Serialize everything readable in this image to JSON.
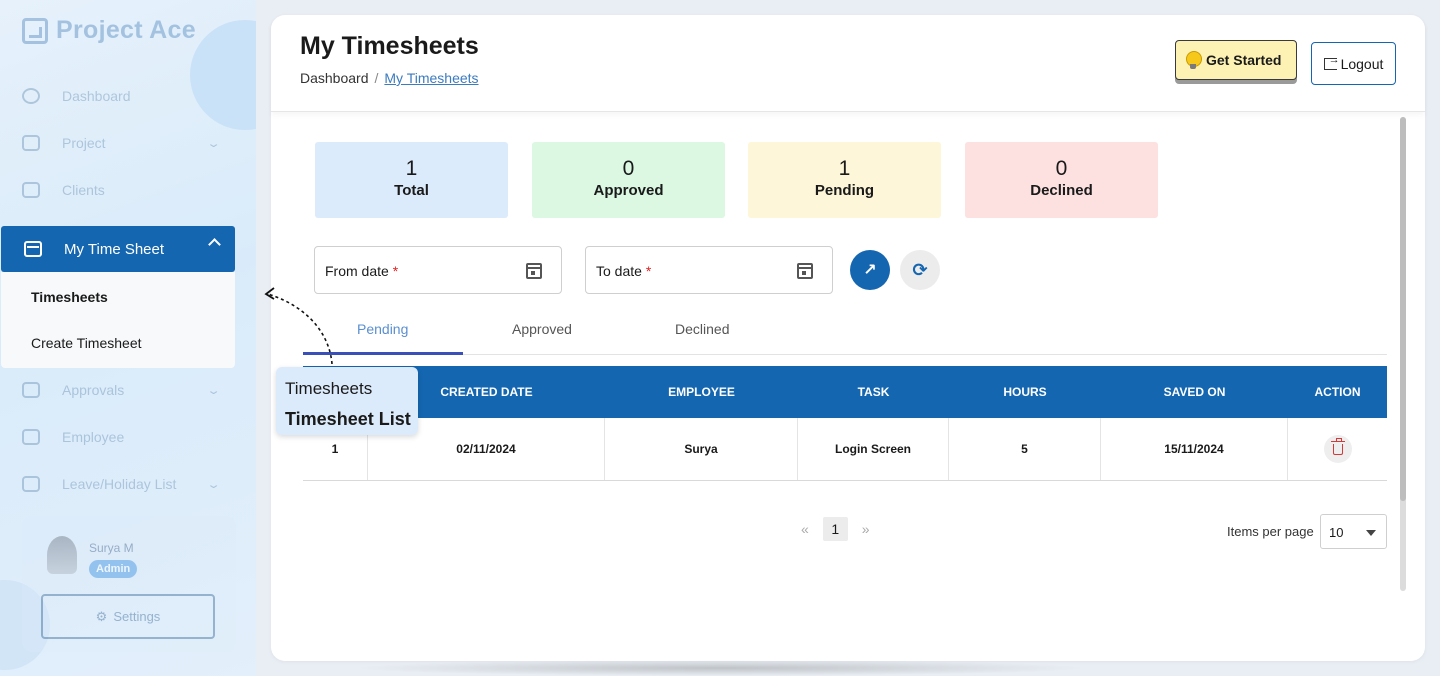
{
  "brand": {
    "name": "Project Ace"
  },
  "sidebar": {
    "items": [
      {
        "label": "Dashboard"
      },
      {
        "label": "Project"
      },
      {
        "label": "Clients"
      },
      {
        "label": "My Time Sheet"
      },
      {
        "label": "Approvals"
      },
      {
        "label": "Employee"
      },
      {
        "label": "Leave/Holiday List"
      }
    ],
    "submenu": [
      {
        "label": "Timesheets"
      },
      {
        "label": "Create Timesheet"
      }
    ],
    "profile": {
      "name": "Surya M",
      "role": "Admin",
      "settings_label": "Settings"
    }
  },
  "header": {
    "title": "My Timesheets",
    "breadcrumb": {
      "home": "Dashboard",
      "separator": "/",
      "current": "My Timesheets"
    },
    "get_started_label": "Get Started",
    "logout_label": "Logout"
  },
  "stats": {
    "total": {
      "value": "1",
      "label": "Total",
      "color": "#dcebfb"
    },
    "approved": {
      "value": "0",
      "label": "Approved",
      "color": "#dcf8e3"
    },
    "pending": {
      "value": "1",
      "label": "Pending",
      "color": "#fdf6d8"
    },
    "declined": {
      "value": "0",
      "label": "Declined",
      "color": "#fde1e1"
    }
  },
  "filters": {
    "from_label": "From date",
    "to_label": "To date",
    "required_mark": "*"
  },
  "tabs": [
    {
      "label": "Pending",
      "active": true
    },
    {
      "label": "Approved",
      "active": false
    },
    {
      "label": "Declined",
      "active": false
    }
  ],
  "table": {
    "columns": [
      "",
      "CREATED DATE",
      "EMPLOYEE",
      "TASK",
      "HOURS",
      "SAVED ON",
      "ACTION"
    ],
    "rows": [
      {
        "no": "1",
        "created": "02/11/2024",
        "employee": "Surya",
        "task": "Login Screen",
        "hours": "5",
        "saved_on": "15/11/2024"
      }
    ]
  },
  "pagination": {
    "prev": "«",
    "current": "1",
    "next": "»",
    "items_per_page_label": "Items per page",
    "items_per_page": "10"
  },
  "tour_tip": {
    "line1": "Timesheets",
    "line2": "Timesheet List"
  },
  "colors": {
    "primary": "#1466b0",
    "tab_active": "#3a4fb8",
    "danger": "#d23a3a"
  }
}
